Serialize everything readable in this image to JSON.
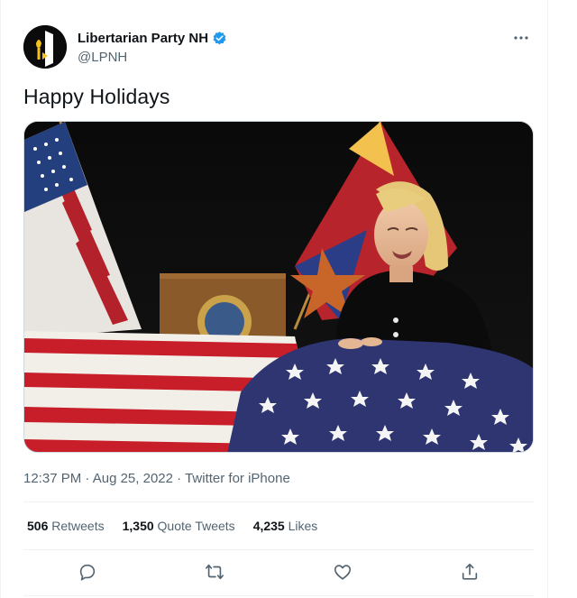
{
  "account": {
    "name": "Libertarian Party NH",
    "handle": "@LPNH",
    "verified": true
  },
  "tweet": {
    "text": "Happy Holidays",
    "time": "12:37 PM",
    "date": "Aug 25, 2022",
    "source": "Twitter for iPhone",
    "separator": "·"
  },
  "stats": {
    "retweets_count": "506",
    "retweets_label": "Retweets",
    "quotes_count": "1,350",
    "quotes_label": "Quote Tweets",
    "likes_count": "4,235",
    "likes_label": "Likes"
  },
  "icons": {
    "more": "more-icon",
    "reply": "reply-icon",
    "retweet": "retweet-icon",
    "like": "like-icon",
    "share": "share-icon",
    "verified": "verified-badge-icon"
  },
  "colors": {
    "accent": "#1d9bf0",
    "text": "#0f1419",
    "secondary": "#536471",
    "border": "#eff3f4"
  }
}
